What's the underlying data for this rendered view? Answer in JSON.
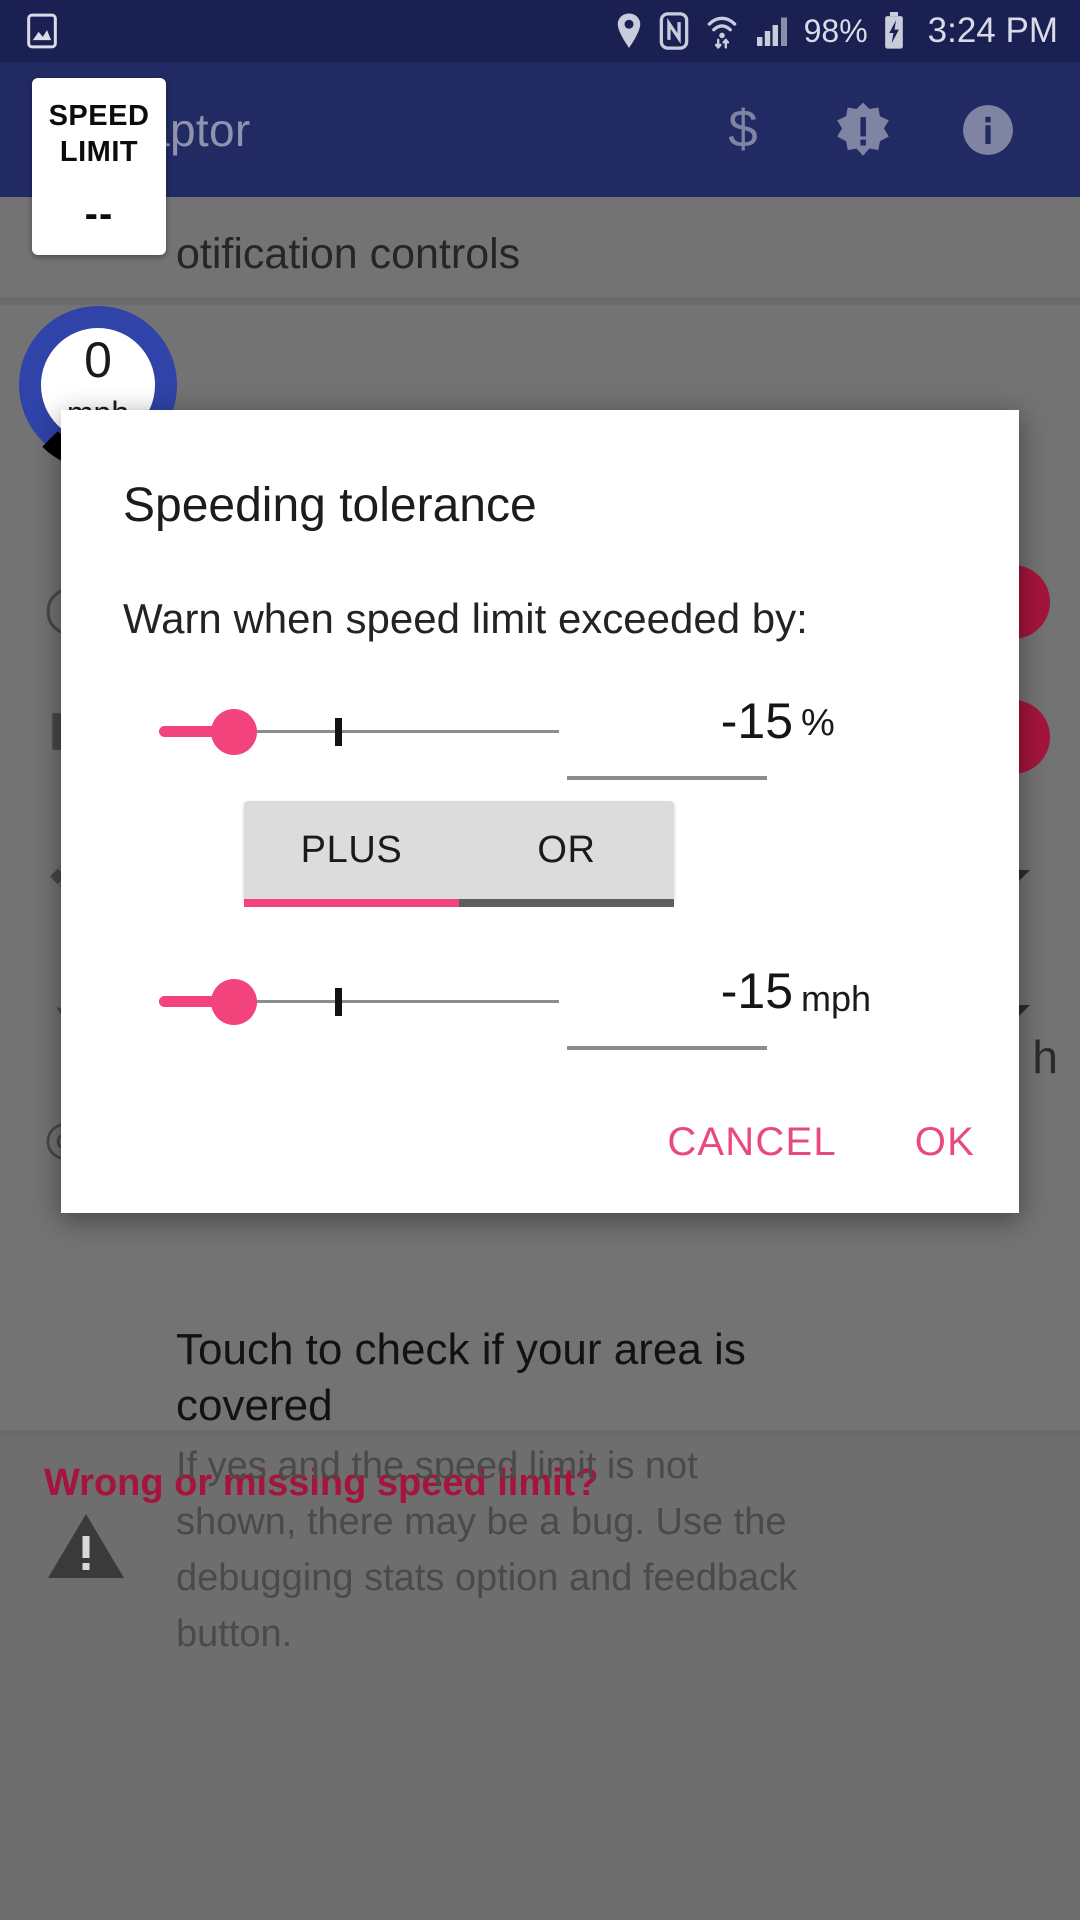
{
  "status_bar": {
    "icons": [
      "image-icon",
      "location-pin-icon",
      "nfc-icon",
      "wifi-icon",
      "cellular-signal-icon",
      "battery-charging-icon"
    ],
    "battery": "98%",
    "clock": "3:24 PM"
  },
  "app_bar": {
    "title": "iraptor",
    "actions": [
      "dollar-icon",
      "alert-badge-icon",
      "info-icon"
    ]
  },
  "speed_limit_sign": {
    "line1": "SPEED",
    "line2": "LIMIT",
    "value": "--"
  },
  "speedometer": {
    "value": "0",
    "unit": "mph",
    "ring_color": "#2f43a8",
    "arc_color": "#000000"
  },
  "background": {
    "notification_row_label": "otification controls",
    "mph_fragment": "h",
    "warning_link": "Wrong or missing speed limit?",
    "coverage_title": "Touch to check if your area is covered",
    "coverage_subtitle": "If yes and the speed limit is not shown, there may be a bug. Use the debugging stats option and feedback button.",
    "warning_icon": "warning-triangle-icon"
  },
  "dialog": {
    "title": "Speeding tolerance",
    "message": "Warn when speed limit exceeded by:",
    "percent_slider": {
      "value": "-15",
      "unit": "%",
      "name": "percent-tolerance-slider"
    },
    "unit_slider": {
      "value": "-15",
      "unit": "mph",
      "name": "speed-tolerance-slider"
    },
    "mode_tabs": {
      "options": [
        "PLUS",
        "OR"
      ],
      "selected": "PLUS"
    },
    "buttons": {
      "cancel": "CANCEL",
      "ok": "OK"
    },
    "accent_color": "#e94a7d"
  }
}
